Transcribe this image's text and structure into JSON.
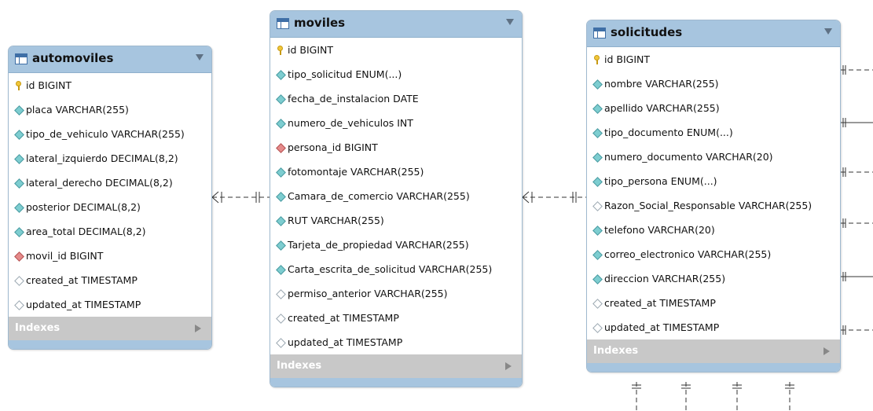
{
  "entities": {
    "automoviles": {
      "title": "automoviles",
      "columns": [
        {
          "text": "id BIGINT",
          "icon": "key"
        },
        {
          "text": "placa VARCHAR(255)",
          "icon": "dia"
        },
        {
          "text": "tipo_de_vehiculo VARCHAR(255)",
          "icon": "dia"
        },
        {
          "text": "lateral_izquierdo DECIMAL(8,2)",
          "icon": "dia"
        },
        {
          "text": "lateral_derecho DECIMAL(8,2)",
          "icon": "dia"
        },
        {
          "text": "posterior DECIMAL(8,2)",
          "icon": "dia"
        },
        {
          "text": "area_total DECIMAL(8,2)",
          "icon": "dia"
        },
        {
          "text": "movil_id BIGINT",
          "icon": "fk"
        },
        {
          "text": "created_at TIMESTAMP",
          "icon": "open"
        },
        {
          "text": "updated_at TIMESTAMP",
          "icon": "open"
        }
      ],
      "indexes_label": "Indexes"
    },
    "moviles": {
      "title": "moviles",
      "columns": [
        {
          "text": "id BIGINT",
          "icon": "key"
        },
        {
          "text": "tipo_solicitud ENUM(...)",
          "icon": "dia"
        },
        {
          "text": "fecha_de_instalacion DATE",
          "icon": "dia"
        },
        {
          "text": "numero_de_vehiculos INT",
          "icon": "dia"
        },
        {
          "text": "persona_id BIGINT",
          "icon": "fk"
        },
        {
          "text": "fotomontaje VARCHAR(255)",
          "icon": "dia"
        },
        {
          "text": "Camara_de_comercio VARCHAR(255)",
          "icon": "dia"
        },
        {
          "text": "RUT VARCHAR(255)",
          "icon": "dia"
        },
        {
          "text": "Tarjeta_de_propiedad VARCHAR(255)",
          "icon": "dia"
        },
        {
          "text": "Carta_escrita_de_solicitud VARCHAR(255)",
          "icon": "dia"
        },
        {
          "text": "permiso_anterior VARCHAR(255)",
          "icon": "open"
        },
        {
          "text": "created_at TIMESTAMP",
          "icon": "open"
        },
        {
          "text": "updated_at TIMESTAMP",
          "icon": "open"
        }
      ],
      "indexes_label": "Indexes"
    },
    "solicitudes": {
      "title": "solicitudes",
      "columns": [
        {
          "text": "id BIGINT",
          "icon": "key"
        },
        {
          "text": "nombre VARCHAR(255)",
          "icon": "dia"
        },
        {
          "text": "apellido VARCHAR(255)",
          "icon": "dia"
        },
        {
          "text": "tipo_documento ENUM(...)",
          "icon": "dia"
        },
        {
          "text": "numero_documento VARCHAR(20)",
          "icon": "dia"
        },
        {
          "text": "tipo_persona ENUM(...)",
          "icon": "dia"
        },
        {
          "text": "Razon_Social_Responsable VARCHAR(255)",
          "icon": "open"
        },
        {
          "text": "telefono VARCHAR(20)",
          "icon": "dia"
        },
        {
          "text": "correo_electronico VARCHAR(255)",
          "icon": "dia"
        },
        {
          "text": "direccion VARCHAR(255)",
          "icon": "dia"
        },
        {
          "text": "created_at TIMESTAMP",
          "icon": "open"
        },
        {
          "text": "updated_at TIMESTAMP",
          "icon": "open"
        }
      ],
      "indexes_label": "Indexes"
    }
  },
  "colors": {
    "header": "#a7c5df",
    "border": "#9fb9cf",
    "indexes_bar": "#c8c8c8",
    "line": "#333333"
  }
}
